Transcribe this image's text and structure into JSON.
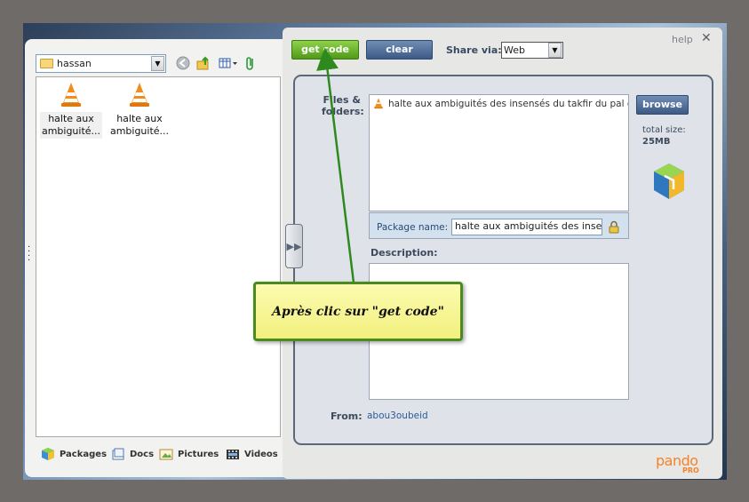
{
  "left_panel": {
    "folder": "hassan",
    "files": [
      {
        "label": "halte aux ambiguité..."
      },
      {
        "label": "halte aux ambiguité..."
      }
    ],
    "tabs": [
      {
        "label": "Packages",
        "icon": "package-icon"
      },
      {
        "label": "Docs",
        "icon": "docs-icon"
      },
      {
        "label": "Pictures",
        "icon": "pictures-icon"
      },
      {
        "label": "Videos",
        "icon": "videos-icon"
      }
    ]
  },
  "toolbar": {
    "get_code_label": "get code",
    "clear_label": "clear",
    "share_label": "Share via:",
    "share_value": "Web",
    "help_label": "help",
    "close_label": "✕"
  },
  "form": {
    "files_label": "Files & folders:",
    "file_entry": "halte aux ambiguités des insensés du takfir du pal dars...",
    "browse_label": "browse",
    "total_size_label": "total size:",
    "total_size_value": "25MB",
    "package_name_label": "Package name:",
    "package_name_value": "halte aux ambiguités des insensés",
    "description_label": "Description:",
    "description_value": "",
    "from_label": "From:",
    "from_value": "abou3oubeid"
  },
  "branding": {
    "logo": "pando",
    "logo_sub": "PRO"
  },
  "annotation": {
    "text": "Après clic sur \"get code\""
  },
  "colors": {
    "accent_green": "#5fa82a",
    "button_blue": "#4a6892",
    "brand_orange": "#f5822a",
    "callout_border": "#4a8a1e"
  }
}
